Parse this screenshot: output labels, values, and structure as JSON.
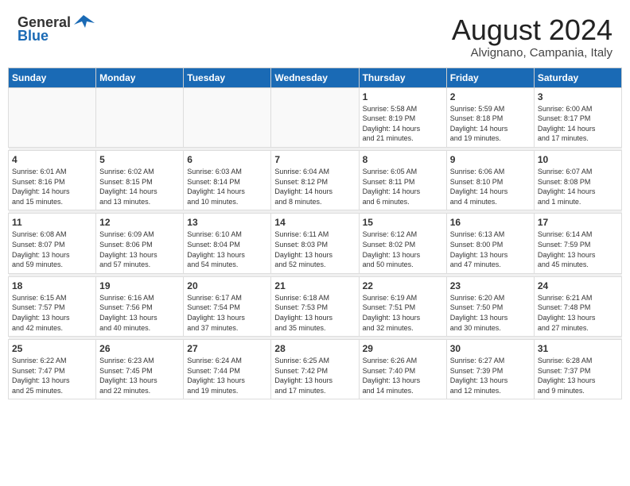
{
  "header": {
    "logo_line1": "General",
    "logo_line2": "Blue",
    "month_title": "August 2024",
    "location": "Alvignano, Campania, Italy"
  },
  "days_of_week": [
    "Sunday",
    "Monday",
    "Tuesday",
    "Wednesday",
    "Thursday",
    "Friday",
    "Saturday"
  ],
  "weeks": [
    [
      {
        "day": "",
        "info": ""
      },
      {
        "day": "",
        "info": ""
      },
      {
        "day": "",
        "info": ""
      },
      {
        "day": "",
        "info": ""
      },
      {
        "day": "1",
        "info": "Sunrise: 5:58 AM\nSunset: 8:19 PM\nDaylight: 14 hours\nand 21 minutes."
      },
      {
        "day": "2",
        "info": "Sunrise: 5:59 AM\nSunset: 8:18 PM\nDaylight: 14 hours\nand 19 minutes."
      },
      {
        "day": "3",
        "info": "Sunrise: 6:00 AM\nSunset: 8:17 PM\nDaylight: 14 hours\nand 17 minutes."
      }
    ],
    [
      {
        "day": "4",
        "info": "Sunrise: 6:01 AM\nSunset: 8:16 PM\nDaylight: 14 hours\nand 15 minutes."
      },
      {
        "day": "5",
        "info": "Sunrise: 6:02 AM\nSunset: 8:15 PM\nDaylight: 14 hours\nand 13 minutes."
      },
      {
        "day": "6",
        "info": "Sunrise: 6:03 AM\nSunset: 8:14 PM\nDaylight: 14 hours\nand 10 minutes."
      },
      {
        "day": "7",
        "info": "Sunrise: 6:04 AM\nSunset: 8:12 PM\nDaylight: 14 hours\nand 8 minutes."
      },
      {
        "day": "8",
        "info": "Sunrise: 6:05 AM\nSunset: 8:11 PM\nDaylight: 14 hours\nand 6 minutes."
      },
      {
        "day": "9",
        "info": "Sunrise: 6:06 AM\nSunset: 8:10 PM\nDaylight: 14 hours\nand 4 minutes."
      },
      {
        "day": "10",
        "info": "Sunrise: 6:07 AM\nSunset: 8:08 PM\nDaylight: 14 hours\nand 1 minute."
      }
    ],
    [
      {
        "day": "11",
        "info": "Sunrise: 6:08 AM\nSunset: 8:07 PM\nDaylight: 13 hours\nand 59 minutes."
      },
      {
        "day": "12",
        "info": "Sunrise: 6:09 AM\nSunset: 8:06 PM\nDaylight: 13 hours\nand 57 minutes."
      },
      {
        "day": "13",
        "info": "Sunrise: 6:10 AM\nSunset: 8:04 PM\nDaylight: 13 hours\nand 54 minutes."
      },
      {
        "day": "14",
        "info": "Sunrise: 6:11 AM\nSunset: 8:03 PM\nDaylight: 13 hours\nand 52 minutes."
      },
      {
        "day": "15",
        "info": "Sunrise: 6:12 AM\nSunset: 8:02 PM\nDaylight: 13 hours\nand 50 minutes."
      },
      {
        "day": "16",
        "info": "Sunrise: 6:13 AM\nSunset: 8:00 PM\nDaylight: 13 hours\nand 47 minutes."
      },
      {
        "day": "17",
        "info": "Sunrise: 6:14 AM\nSunset: 7:59 PM\nDaylight: 13 hours\nand 45 minutes."
      }
    ],
    [
      {
        "day": "18",
        "info": "Sunrise: 6:15 AM\nSunset: 7:57 PM\nDaylight: 13 hours\nand 42 minutes."
      },
      {
        "day": "19",
        "info": "Sunrise: 6:16 AM\nSunset: 7:56 PM\nDaylight: 13 hours\nand 40 minutes."
      },
      {
        "day": "20",
        "info": "Sunrise: 6:17 AM\nSunset: 7:54 PM\nDaylight: 13 hours\nand 37 minutes."
      },
      {
        "day": "21",
        "info": "Sunrise: 6:18 AM\nSunset: 7:53 PM\nDaylight: 13 hours\nand 35 minutes."
      },
      {
        "day": "22",
        "info": "Sunrise: 6:19 AM\nSunset: 7:51 PM\nDaylight: 13 hours\nand 32 minutes."
      },
      {
        "day": "23",
        "info": "Sunrise: 6:20 AM\nSunset: 7:50 PM\nDaylight: 13 hours\nand 30 minutes."
      },
      {
        "day": "24",
        "info": "Sunrise: 6:21 AM\nSunset: 7:48 PM\nDaylight: 13 hours\nand 27 minutes."
      }
    ],
    [
      {
        "day": "25",
        "info": "Sunrise: 6:22 AM\nSunset: 7:47 PM\nDaylight: 13 hours\nand 25 minutes."
      },
      {
        "day": "26",
        "info": "Sunrise: 6:23 AM\nSunset: 7:45 PM\nDaylight: 13 hours\nand 22 minutes."
      },
      {
        "day": "27",
        "info": "Sunrise: 6:24 AM\nSunset: 7:44 PM\nDaylight: 13 hours\nand 19 minutes."
      },
      {
        "day": "28",
        "info": "Sunrise: 6:25 AM\nSunset: 7:42 PM\nDaylight: 13 hours\nand 17 minutes."
      },
      {
        "day": "29",
        "info": "Sunrise: 6:26 AM\nSunset: 7:40 PM\nDaylight: 13 hours\nand 14 minutes."
      },
      {
        "day": "30",
        "info": "Sunrise: 6:27 AM\nSunset: 7:39 PM\nDaylight: 13 hours\nand 12 minutes."
      },
      {
        "day": "31",
        "info": "Sunrise: 6:28 AM\nSunset: 7:37 PM\nDaylight: 13 hours\nand 9 minutes."
      }
    ]
  ]
}
